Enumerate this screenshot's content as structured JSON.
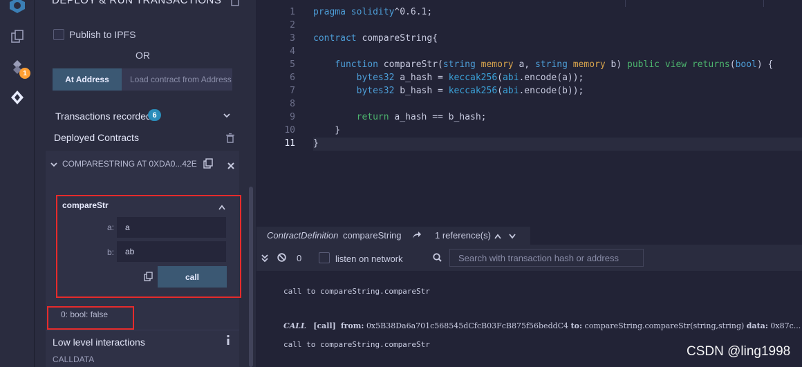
{
  "panel": {
    "title": "DEPLOY & RUN TRANSACTIONS",
    "publish_label": "Publish to IPFS",
    "or_label": "OR",
    "at_address_button": "At Address",
    "load_contract_placeholder": "Load contract from Address",
    "transactions_recorded_label": "Transactions recorded",
    "transactions_recorded_count": "6",
    "deployed_contracts_label": "Deployed Contracts",
    "instance_title": "COMPARESTRING AT 0XDA0...42E",
    "function_name": "compareStr",
    "params": [
      {
        "label": "a:",
        "value": "a"
      },
      {
        "label": "b:",
        "value": "ab"
      }
    ],
    "call_button": "call",
    "result": "0: bool: false",
    "low_level_label": "Low level interactions",
    "calldata_label": "CALLDATA"
  },
  "iconbar": {
    "plugin_badge": "1",
    "icons": [
      "remix-logo-icon",
      "file-explorer-icon",
      "solidity-compiler-icon",
      "deploy-icon"
    ]
  },
  "editor": {
    "line_numbers": [
      "1",
      "2",
      "3",
      "4",
      "5",
      "6",
      "7",
      "8",
      "9",
      "10",
      "11"
    ],
    "active_line": "11"
  },
  "defbar": {
    "kind": "ContractDefinition",
    "name": "compareString",
    "references": "1 reference(s)"
  },
  "terminal": {
    "pending_count": "0",
    "listen_label": "listen on network",
    "search_placeholder": "Search with transaction hash or address",
    "log1": "call to compareString.compareStr",
    "call_tag": "CALL",
    "call_kind": "[call]",
    "from_label": "from:",
    "from_value": "0x5B38Da6a701c568545dCfcB03FcB875f56beddC4",
    "to_label": "to:",
    "to_value": "compareString.compareStr(string,string)",
    "data_label": "data:",
    "data_value": "0x87c...",
    "log2": "call to compareString.compareStr"
  },
  "watermark": "CSDN @ling1998",
  "colors": {
    "accent": "#3b5873",
    "highlight_box": "#e62b2b",
    "badge_blue": "#2b8dba",
    "badge_orange": "#ff9f33"
  }
}
